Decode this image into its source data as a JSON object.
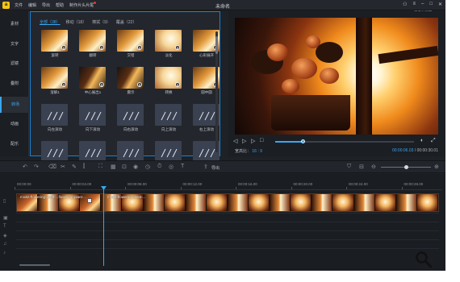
{
  "titlebar": {
    "logo": "a",
    "menu": [
      "文件",
      "编辑",
      "导出",
      "帮助",
      "制作片头片尾"
    ],
    "title": "未命名",
    "autosave": "已自动保存 15:36"
  },
  "leftnav": {
    "items": [
      "素材",
      "文字",
      "滤镜",
      "叠附",
      "转场",
      "动画",
      "配乐"
    ],
    "active_index": 4
  },
  "library": {
    "tabs": [
      "全部（38）",
      "移动（18）",
      "擦拭（9）",
      "覆盖（22）"
    ],
    "active_tab": 0,
    "tiles": [
      {
        "label": "旋转",
        "style": "warm"
      },
      {
        "label": "翻转",
        "style": "warm"
      },
      {
        "label": "交错",
        "style": "warm"
      },
      {
        "label": "淡化",
        "style": "bright"
      },
      {
        "label": "心形展开",
        "style": "warm"
      },
      {
        "label": "溶解1",
        "style": "warm"
      },
      {
        "label": "中心展出1",
        "style": "dark"
      },
      {
        "label": "震示",
        "style": "dark"
      },
      {
        "label": "转换",
        "style": "bright"
      },
      {
        "label": "圆中圆",
        "style": "warm"
      },
      {
        "label": "向左滚动",
        "style": "arrows"
      },
      {
        "label": "向下滚动",
        "style": "arrows"
      },
      {
        "label": "向右滚动",
        "style": "arrows"
      },
      {
        "label": "向上滚动",
        "style": "arrows"
      },
      {
        "label": "右上滚动",
        "style": "arrows"
      },
      {
        "label": "",
        "style": "arrows"
      },
      {
        "label": "",
        "style": "arrows"
      },
      {
        "label": "",
        "style": "arrows"
      },
      {
        "label": "",
        "style": "arrows"
      },
      {
        "label": "",
        "style": "arrows"
      }
    ]
  },
  "preview": {
    "aspect_label": "宽高比：",
    "aspect_value": "16 : 9",
    "current_time": "00:00:06.03",
    "separator": "/",
    "total_time": "00:00:30.01",
    "progress": 0.2
  },
  "toolbar": {
    "export_label": "导出",
    "zoom_level": 0.5
  },
  "timeline": {
    "ruler": [
      "00:00:00",
      "00:00:04.00",
      "00:00:08.00",
      "00:00:12.00",
      "00:00:16.00",
      "00:00:20.00",
      "00:00:24.00",
      "00:00:28.00"
    ],
    "clips": [
      {
        "label": "mixkit-flowering-plant-...flowering-plant-..."
      },
      {
        "label": "mixkit-flowering-plant-..."
      }
    ]
  },
  "colors": {
    "accent": "#39a7f0",
    "background": "#1e2126",
    "logo": "#f5c518"
  },
  "icons": [
    "search-zoom-icon",
    "user-icon",
    "minimize-icon",
    "maximize-icon",
    "close-icon"
  ]
}
